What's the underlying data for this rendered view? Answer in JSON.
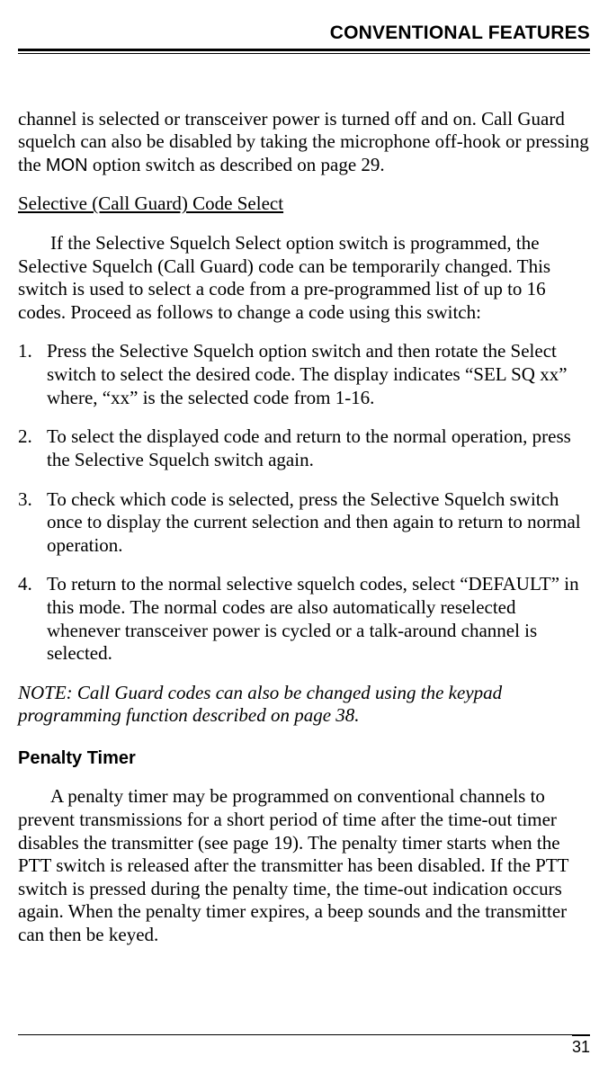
{
  "header": {
    "section_title": "CONVENTIONAL FEATURES"
  },
  "intro_para": {
    "pre": "channel is selected or transceiver power is turned off and on. Call Guard squelch can also be disabled by taking the microphone off-hook or pressing the ",
    "mon": "MON",
    "post": " option switch as described on page 29."
  },
  "subheading": "Selective (Call Guard) Code Select",
  "sub_para": "If the Selective Squelch Select option switch is programmed, the Selective Squelch (Call Guard) code can be temporarily changed. This switch is used to select a code from a pre-programmed list of up to 16 codes. Proceed as follows to change a code using this switch:",
  "steps": [
    "Press the Selective Squelch option switch and then rotate the Select switch to select the desired code. The display indicates “SEL SQ xx” where, “xx” is the selected code from 1-16.",
    "To select the displayed code and return to the normal operation, press the Selective Squelch switch again.",
    "To check which code is selected, press the Selective Squelch switch once to display the current selection and then again to return to normal operation.",
    "To return to the normal selective squelch codes, select “DEFAULT” in this mode. The normal codes are also automatically reselected whenever transceiver power is cycled or a talk-around channel is selected."
  ],
  "note": "NOTE: Call Guard codes can also be changed using the keypad programming function described on page 38.",
  "section2": {
    "heading": "Penalty Timer",
    "para": "A penalty timer may be programmed on conventional channels to prevent transmissions for a short period of time after the time-out timer disables the transmitter (see page 19). The penalty timer starts when the PTT switch is released after the transmitter has been disabled. If the PTT switch is pressed during the penalty time, the time-out indication occurs again. When the penalty timer expires, a beep sounds and the transmitter can then be keyed."
  },
  "page_number": "31"
}
